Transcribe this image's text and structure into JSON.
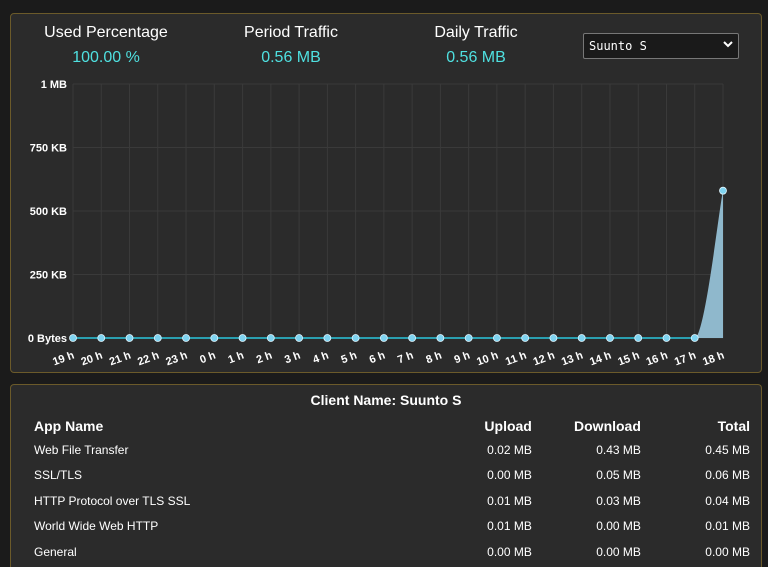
{
  "stats": {
    "used": {
      "label": "Used Percentage",
      "value": "100.00 %"
    },
    "period": {
      "label": "Period Traffic",
      "value": "0.56 MB"
    },
    "daily": {
      "label": "Daily Traffic",
      "value": "0.56 MB"
    }
  },
  "client_select": {
    "value": "Suunto S",
    "icon": "chevron-down-icon"
  },
  "chart_data": {
    "type": "area",
    "x": [
      "19 h",
      "20 h",
      "21 h",
      "22 h",
      "23 h",
      "0 h",
      "1 h",
      "2 h",
      "3 h",
      "4 h",
      "5 h",
      "6 h",
      "7 h",
      "8 h",
      "9 h",
      "10 h",
      "11 h",
      "12 h",
      "13 h",
      "14 h",
      "15 h",
      "16 h",
      "17 h",
      "18 h"
    ],
    "values": [
      0,
      0,
      0,
      0,
      0,
      0,
      0,
      0,
      0,
      0,
      0,
      0,
      0,
      0,
      0,
      0,
      0,
      0,
      0,
      0,
      0,
      0,
      0,
      0.58
    ],
    "y_ticks": [
      "0 Bytes",
      "250 KB",
      "500 KB",
      "750 KB",
      "1 MB"
    ],
    "ylim": [
      0,
      1
    ],
    "y_unit": "MB",
    "colors": {
      "fill": "#8fb8cc",
      "line": "#2a9fb0",
      "point": "#7fd3f0",
      "grid": "#3a3a3a"
    }
  },
  "client_table": {
    "title": "Client Name: Suunto S",
    "headers": {
      "name": "App Name",
      "upload": "Upload",
      "download": "Download",
      "total": "Total"
    },
    "rows": [
      {
        "name": "Web File Transfer",
        "upload": "0.02 MB",
        "download": "0.43 MB",
        "total": "0.45 MB"
      },
      {
        "name": "SSL/TLS",
        "upload": "0.00 MB",
        "download": "0.05 MB",
        "total": "0.06 MB"
      },
      {
        "name": "HTTP Protocol over TLS SSL",
        "upload": "0.01 MB",
        "download": "0.03 MB",
        "total": "0.04 MB"
      },
      {
        "name": "World Wide Web HTTP",
        "upload": "0.01 MB",
        "download": "0.00 MB",
        "total": "0.01 MB"
      },
      {
        "name": "General",
        "upload": "0.00 MB",
        "download": "0.00 MB",
        "total": "0.00 MB"
      }
    ]
  }
}
